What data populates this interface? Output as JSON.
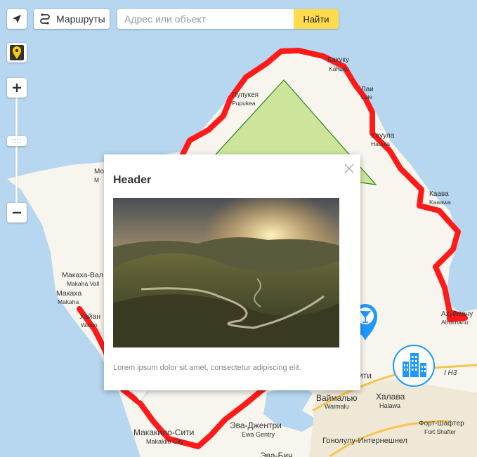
{
  "controls": {
    "routes_label": "Маршруты",
    "search_placeholder": "Адрес или объект",
    "search_button": "Найти",
    "zoom_handle": "::::"
  },
  "balloon": {
    "header": "Header",
    "body": "Lorem ipsum dolor sit amet, consectetur adipiscing elit."
  },
  "map_labels": {
    "kahuku_ru": "Кахуку",
    "kahuku_en": "Kahuku",
    "laie_ru": "Лаи",
    "laie_en": "Laie",
    "pupukea_ru": "Пупукея",
    "pupukea_en": "Pupukea",
    "hauula_ru": "Хауула",
    "hauula_en": "Hauula",
    "kaaawa_ru": "Каава",
    "kaaawa_en": "Kaaawa",
    "mokuleia_ru": "Мо",
    "mokuleia_en": "M",
    "makaha_valley_ru": "Макаха-Вал",
    "makaha_valley_en": "Makaha Vall",
    "makaha_ru": "Макаха",
    "makaha_en": "Makaha",
    "waianae_ru": "Уайан",
    "waianae_en": "Waian",
    "ahuimanu_ru": "Ахуйману",
    "ahuimanu_en": "Ahuimanu",
    "mililani_ru": "ити",
    "waimalu_ru": "Ваймалью",
    "waimalu_en": "Waimalu",
    "halawa_ru": "Халава",
    "halawa_en": "Halawa",
    "h3": "I H3",
    "fort_shafter_ru": "Форт-Шафтер",
    "fort_shafter_en": "Fort Shafter",
    "ewa_gentry_ru": "Эва-Джентри",
    "ewa_gentry_en": "Ewa Gentry",
    "makakilo_ru": "Макакило-Сити",
    "makakilo_en": "Makakilo City",
    "honolulu_airport_ru": "Гонолулу-Интернешнел",
    "ewa_beach_ru": "Эва-Бич"
  },
  "colors": {
    "water": "#b6d7ef",
    "land": "#f7f5ee",
    "route": "#ff1a1a",
    "triangle_fill": "#c8e391",
    "triangle_stroke": "#2a8a1d",
    "accent": "#ffdb4d",
    "marker": "#1e98ff"
  },
  "icons": {
    "geolocation": "arrow-icon",
    "routes": "route-icon",
    "traffic": "traffic-pin-icon",
    "bar_marker": "cocktail-marker-icon",
    "building_marker": "building-icon"
  }
}
